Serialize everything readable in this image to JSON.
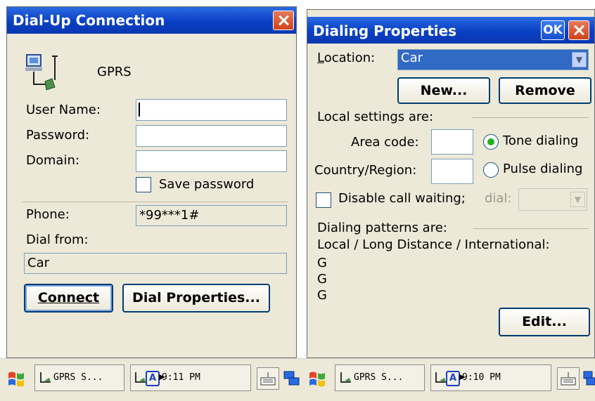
{
  "dialup": {
    "title": "Dial-Up Connection",
    "connection_name": "GPRS",
    "user_name_label": "User Name:",
    "user_name_value": "",
    "password_label": "Password:",
    "password_value": "",
    "domain_label": "Domain:",
    "domain_value": "",
    "save_password_label": "Save password",
    "phone_label": "Phone:",
    "phone_value": "*99***1#",
    "dial_from_label": "Dial from:",
    "dial_from_value": "Car",
    "connect_label": "Connect",
    "dial_properties_label": "Dial Properties..."
  },
  "dialing": {
    "title": "Dialing Properties",
    "ok_label": "OK",
    "location_label": "Location:",
    "location_value": "Car",
    "new_label": "New...",
    "remove_label": "Remove",
    "local_settings_label": "Local settings are:",
    "area_code_label": "Area code:",
    "area_code_value": "",
    "country_label": "Country/Region:",
    "country_value": "",
    "tone_label": "Tone dialing",
    "pulse_label": "Pulse dialing",
    "tone_selected": true,
    "disable_call_waiting_label": "Disable call waiting;",
    "dial_label": "dial:",
    "dial_value": "",
    "patterns_label": "Dialing patterns are:",
    "patterns_header": "Local / Long Distance / International:",
    "patterns": [
      "G",
      "G",
      "G"
    ],
    "edit_label": "Edit..."
  },
  "taskbar_left": {
    "task_label": "GPRS S...",
    "time": "9:11 PM",
    "input_indicator": "A"
  },
  "taskbar_right": {
    "task_label": "GPRS S...",
    "time": "9:10 PM",
    "input_indicator": "A"
  },
  "colors": {
    "titlebar": "#0a3fc4",
    "window_bg": "#ece9d8",
    "close_button": "#d04418",
    "radio_selected": "#22b022"
  }
}
